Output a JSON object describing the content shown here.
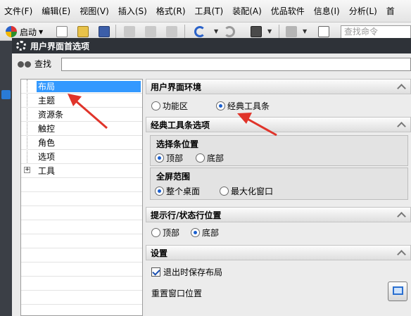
{
  "menubar": {
    "items": [
      "文件(F)",
      "编辑(E)",
      "视图(V)",
      "插入(S)",
      "格式(R)",
      "工具(T)",
      "装配(A)",
      "优品软件",
      "信息(I)",
      "分析(L)",
      "首"
    ]
  },
  "toolbar": {
    "start_label": "启动",
    "search_placeholder": "查找命令"
  },
  "dialog": {
    "title": "用户界面首选项",
    "find_label": "查找",
    "find_value": ""
  },
  "tree": {
    "items": [
      {
        "label": "布局",
        "selected": true
      },
      {
        "label": "主题",
        "selected": false
      },
      {
        "label": "资源条",
        "selected": false
      },
      {
        "label": "触控",
        "selected": false
      },
      {
        "label": "角色",
        "selected": false
      },
      {
        "label": "选项",
        "selected": false
      },
      {
        "label": "工具",
        "selected": false,
        "expand": "+"
      }
    ]
  },
  "sections": {
    "ui_env": {
      "title": "用户界面环境",
      "opt_ribbon": "功能区",
      "opt_classic": "经典工具条",
      "selected": "经典工具条"
    },
    "classic_opts": {
      "title": "经典工具条选项",
      "select_bar": {
        "title": "选择条位置",
        "opt_top": "顶部",
        "opt_bottom": "底部",
        "selected": "顶部"
      },
      "fullscreen": {
        "title": "全屏范围",
        "opt_desktop": "整个桌面",
        "opt_max": "最大化窗口",
        "selected": "整个桌面"
      }
    },
    "prompt_status": {
      "title": "提示行/状态行位置",
      "opt_top": "顶部",
      "opt_bottom": "底部",
      "selected": "底部"
    },
    "settings": {
      "title": "设置",
      "save_layout_label": "退出时保存布局",
      "save_layout_checked": true,
      "reset_label": "重置窗口位置"
    }
  },
  "colors": {
    "selection": "#3399ff",
    "annotation_arrow": "#e0342a",
    "titlebar": "#2e3238"
  }
}
